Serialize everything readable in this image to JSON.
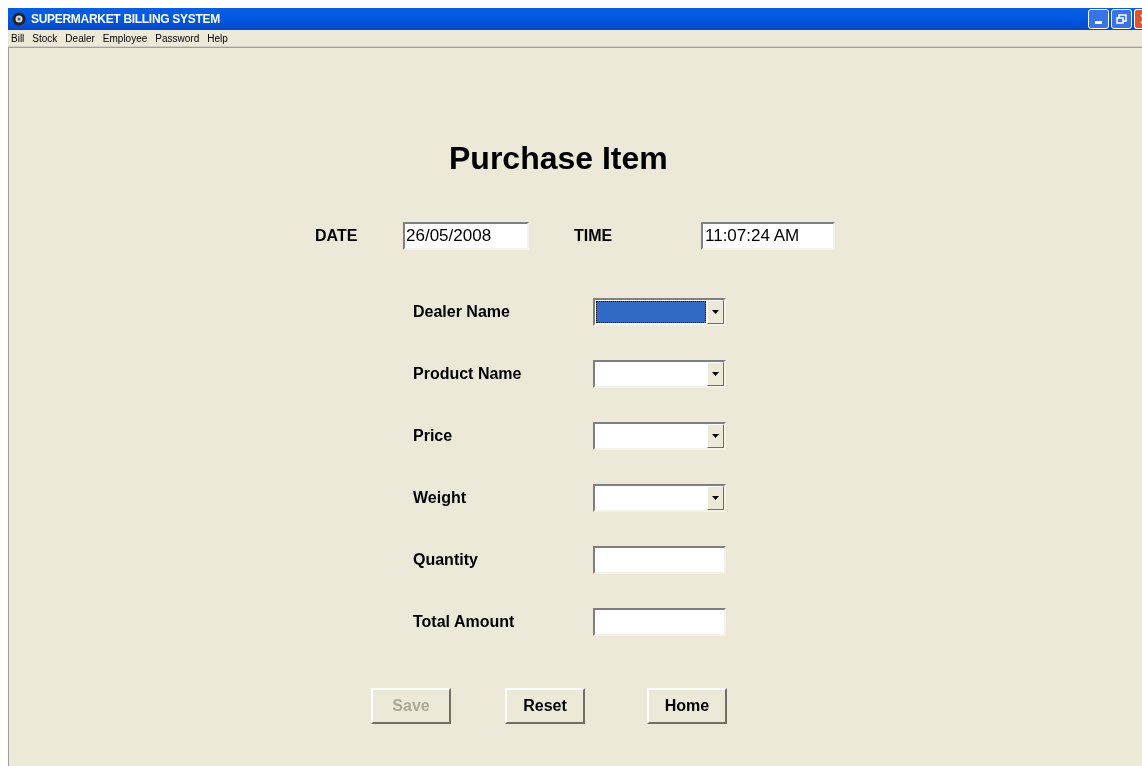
{
  "window": {
    "title": "SUPERMARKET BILLING SYSTEM"
  },
  "menu": [
    "Bill",
    "Stock",
    "Dealer",
    "Employee",
    "Password",
    "Help"
  ],
  "heading": "Purchase Item",
  "date": {
    "label": "DATE",
    "value": "26/05/2008"
  },
  "time": {
    "label": "TIME",
    "value": "11:07:24 AM"
  },
  "fields": [
    {
      "label": "Dealer Name",
      "kind": "combo",
      "focused": true
    },
    {
      "label": "Product Name",
      "kind": "combo",
      "focused": false
    },
    {
      "label": "Price",
      "kind": "combo",
      "focused": false
    },
    {
      "label": "Weight",
      "kind": "combo",
      "focused": false
    },
    {
      "label": "Quantity",
      "kind": "text",
      "focused": false
    },
    {
      "label": "Total Amount",
      "kind": "text",
      "focused": false
    }
  ],
  "buttons": [
    {
      "label": "Save",
      "disabled": true
    },
    {
      "label": "Reset",
      "disabled": false
    },
    {
      "label": "Home",
      "disabled": false
    }
  ]
}
